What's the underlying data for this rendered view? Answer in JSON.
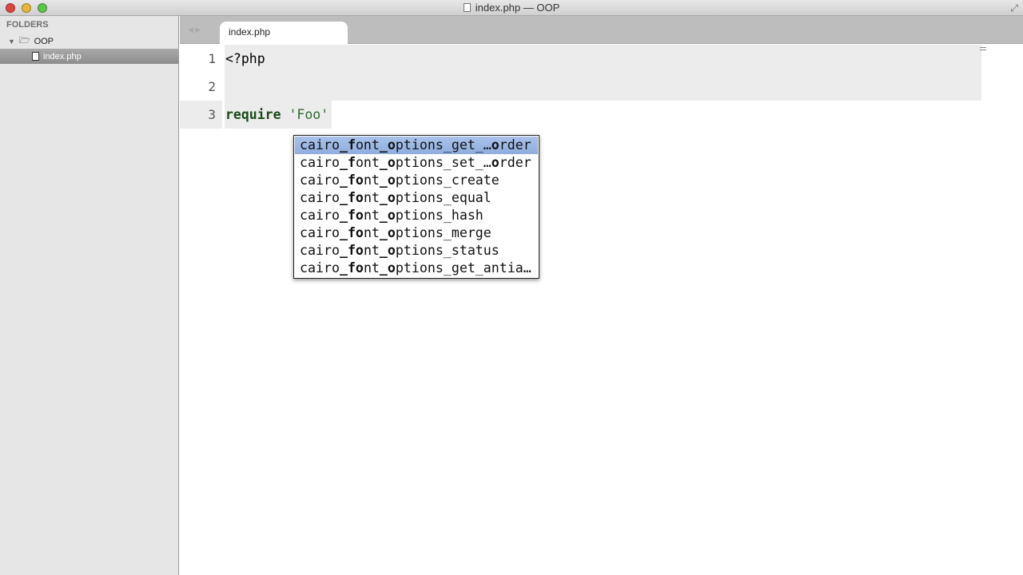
{
  "window": {
    "title": "index.php — OOP",
    "colors": {
      "close": "#e0443e",
      "minimize": "#e8b53a",
      "zoom": "#5ec44a"
    }
  },
  "sidebar": {
    "header": "FOLDERS",
    "folder": "OOP",
    "file": "index.php"
  },
  "tabs": [
    {
      "label": "index.php"
    }
  ],
  "editor": {
    "lines": [
      {
        "num": "1",
        "code": "<?php"
      },
      {
        "num": "2",
        "code": ""
      },
      {
        "num": "3",
        "keyword": "require",
        "string": "'Foo'"
      }
    ]
  },
  "autocomplete": {
    "selected_index": 0,
    "items": [
      [
        {
          "t": "cairo"
        },
        {
          "t": "_f",
          "b": 1
        },
        {
          "t": "ont"
        },
        {
          "t": "_o",
          "b": 1
        },
        {
          "t": "ptions_get_…"
        },
        {
          "t": "o",
          "b": 1
        },
        {
          "t": "rder"
        }
      ],
      [
        {
          "t": "cairo"
        },
        {
          "t": "_f",
          "b": 1
        },
        {
          "t": "ont"
        },
        {
          "t": "_o",
          "b": 1
        },
        {
          "t": "ptions_set_…"
        },
        {
          "t": "o",
          "b": 1
        },
        {
          "t": "rder"
        }
      ],
      [
        {
          "t": "cairo"
        },
        {
          "t": "_fo",
          "b": 1
        },
        {
          "t": "nt"
        },
        {
          "t": "_o",
          "b": 1
        },
        {
          "t": "ptions_create"
        }
      ],
      [
        {
          "t": "cairo"
        },
        {
          "t": "_fo",
          "b": 1
        },
        {
          "t": "nt"
        },
        {
          "t": "_o",
          "b": 1
        },
        {
          "t": "ptions_equal"
        }
      ],
      [
        {
          "t": "cairo"
        },
        {
          "t": "_fo",
          "b": 1
        },
        {
          "t": "nt"
        },
        {
          "t": "_o",
          "b": 1
        },
        {
          "t": "ptions_hash"
        }
      ],
      [
        {
          "t": "cairo"
        },
        {
          "t": "_fo",
          "b": 1
        },
        {
          "t": "nt"
        },
        {
          "t": "_o",
          "b": 1
        },
        {
          "t": "ptions_merge"
        }
      ],
      [
        {
          "t": "cairo"
        },
        {
          "t": "_fo",
          "b": 1
        },
        {
          "t": "nt"
        },
        {
          "t": "_o",
          "b": 1
        },
        {
          "t": "ptions_status"
        }
      ],
      [
        {
          "t": "cairo"
        },
        {
          "t": "_fo",
          "b": 1
        },
        {
          "t": "nt"
        },
        {
          "t": "_o",
          "b": 1
        },
        {
          "t": "ptions_get_antia…"
        }
      ]
    ]
  }
}
